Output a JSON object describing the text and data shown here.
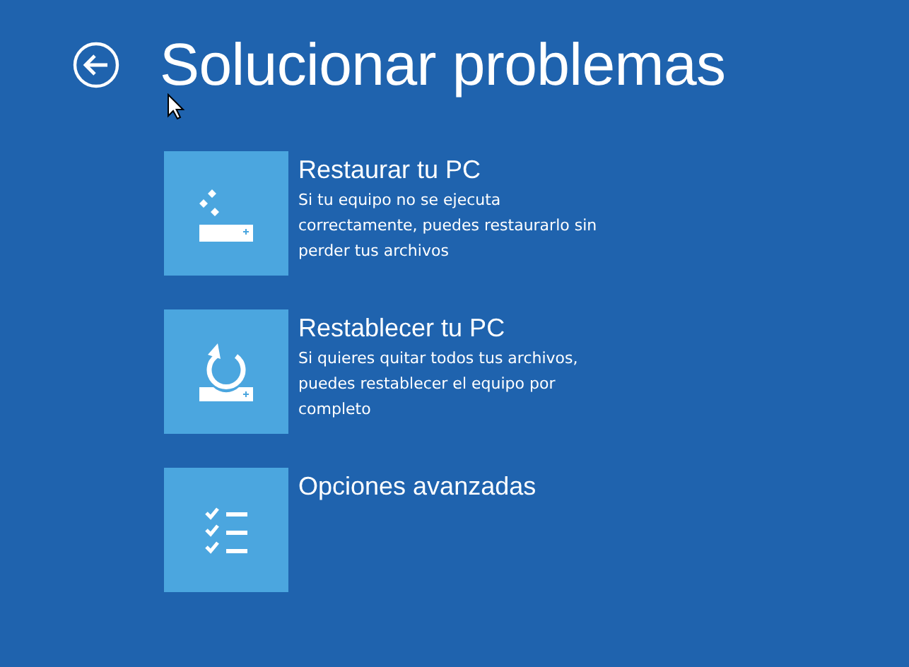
{
  "header": {
    "title": "Solucionar problemas"
  },
  "options": [
    {
      "kind": "restore",
      "title": "Restaurar tu PC",
      "description": "Si tu equipo no se ejecuta correctamente, puedes restaurarlo sin perder tus archivos"
    },
    {
      "kind": "reset",
      "title": "Restablecer tu PC",
      "description": "Si quieres quitar todos tus archivos, puedes restablecer el equipo por completo"
    },
    {
      "kind": "advanced",
      "title": "Opciones avanzadas"
    }
  ]
}
